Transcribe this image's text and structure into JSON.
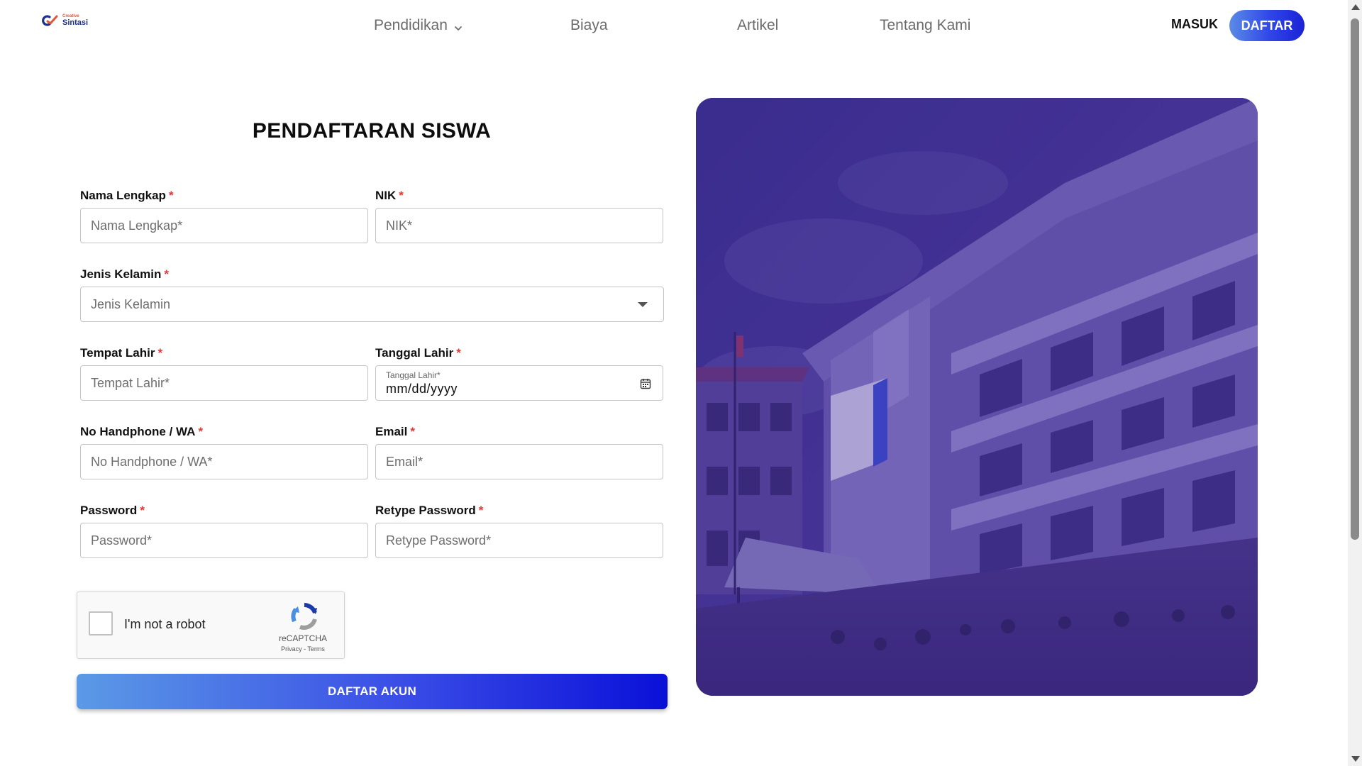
{
  "header": {
    "logo": {
      "small": "Creative",
      "name": "Sintasi"
    },
    "nav": [
      {
        "label": "Pendidikan",
        "has_dropdown": true
      },
      {
        "label": "Biaya"
      },
      {
        "label": "Artikel"
      },
      {
        "label": "Tentang Kami"
      }
    ],
    "login_label": "MASUK",
    "register_label": "DAFTAR"
  },
  "form": {
    "title": "PENDAFTARAN SISWA",
    "required_mark": "*",
    "fields": {
      "nama": {
        "label": "Nama Lengkap",
        "placeholder": "Nama Lengkap*"
      },
      "nik": {
        "label": "NIK",
        "placeholder": "NIK*"
      },
      "gender": {
        "label": "Jenis Kelamin",
        "placeholder": "Jenis Kelamin"
      },
      "tempat": {
        "label": "Tempat Lahir",
        "placeholder": "Tempat Lahir*"
      },
      "tanggal": {
        "label": "Tanggal Lahir",
        "mini_label": "Tanggal Lahir*",
        "value": "mm/dd/yyyy"
      },
      "phone": {
        "label": "No Handphone / WA",
        "placeholder": "No Handphone / WA*"
      },
      "email": {
        "label": "Email",
        "placeholder": "Email*"
      },
      "password": {
        "label": "Password",
        "placeholder": "Password*"
      },
      "retype": {
        "label": "Retype Password",
        "placeholder": "Retype Password*"
      }
    },
    "recaptcha": {
      "label": "I'm not a robot",
      "brand": "reCAPTCHA",
      "links": "Privacy - Terms"
    },
    "submit_label": "DAFTAR AKUN"
  },
  "colors": {
    "accent": "#2f45e8",
    "required": "#e53935",
    "hero_overlay": "#3a2a7e"
  }
}
